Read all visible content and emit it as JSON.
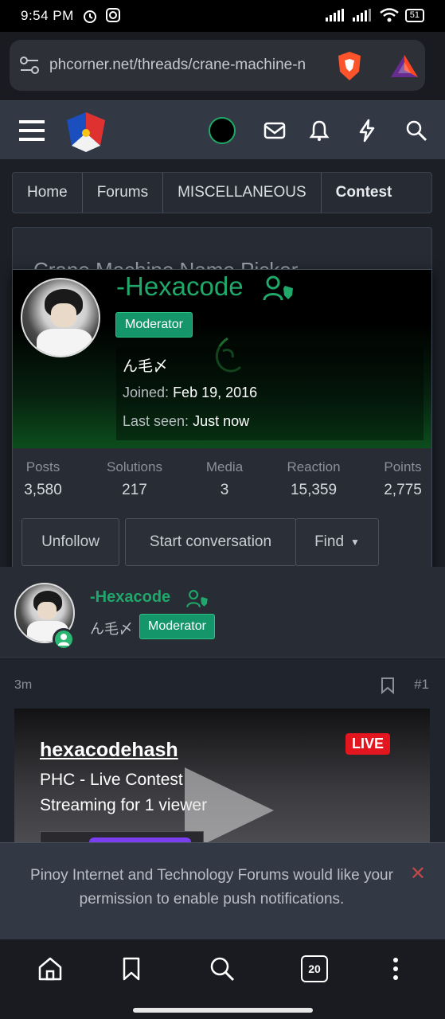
{
  "status_bar": {
    "time": "9:54 PM",
    "battery": "51"
  },
  "browser": {
    "url": "phcorner.net/threads/crane-machine-n",
    "tab_count": "20"
  },
  "breadcrumb": [
    "Home",
    "Forums",
    "MISCELLANEOUS",
    "Contest"
  ],
  "thread": {
    "title_partial": "Crane Machine Name Picker"
  },
  "member_popup": {
    "username": "-Hexacode",
    "badge": "Moderator",
    "custom_title": "ん毛〆",
    "joined_label": "Joined:",
    "joined_value": "Feb 19, 2016",
    "last_seen_label": "Last seen:",
    "last_seen_value": "Just now",
    "stats": [
      {
        "label": "Posts",
        "value": "3,580"
      },
      {
        "label": "Solutions",
        "value": "217"
      },
      {
        "label": "Media",
        "value": "3"
      },
      {
        "label": "Reaction",
        "value": "15,359"
      },
      {
        "label": "Points",
        "value": "2,775"
      }
    ],
    "buttons": {
      "unfollow": "Unfollow",
      "start_conversation": "Start conversation",
      "find": "Find"
    }
  },
  "post": {
    "username": "-Hexacode",
    "custom_title": "ん毛〆",
    "badge": "Moderator",
    "time": "3m",
    "number": "#1",
    "embed": {
      "channel": "hexacodehash",
      "title": "PHC - Live Contest",
      "viewers": "Streaming for 1 viewer",
      "live_label": "LIVE"
    }
  },
  "notification": {
    "text": "Pinoy Internet and Technology Forums would like your permission to enable push notifications.",
    "close": "✕"
  },
  "colors": {
    "accent_green": "#1fa86a",
    "moderator_badge": "#14966a",
    "header_bg": "#323945",
    "live_red": "#e3151e"
  }
}
